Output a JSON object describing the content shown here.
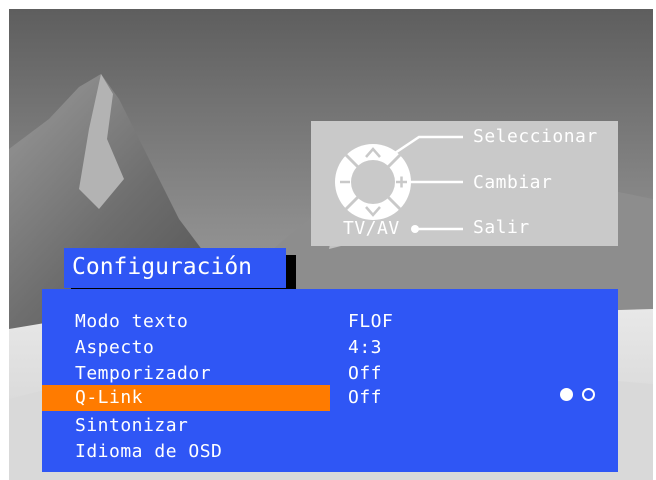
{
  "help_panel": {
    "select_label": "Seleccionar",
    "change_label": "Cambiar",
    "exit_label": "Salir",
    "tvav_label": "TV/AV",
    "icons": [
      "up-arrow-icon",
      "down-arrow-icon",
      "minus-icon",
      "plus-icon",
      "navigation-ring-icon"
    ]
  },
  "menu": {
    "title": "Configuración",
    "items": [
      {
        "label": "Modo texto",
        "value": "FLOF"
      },
      {
        "label": "Aspecto",
        "value": "4:3"
      },
      {
        "label": "Temporizador",
        "value": "Off"
      },
      {
        "label": "Q-Link",
        "value": "Off",
        "selected": true
      },
      {
        "label": "Sintonizar",
        "value": ""
      },
      {
        "label": "Idioma de OSD",
        "value": ""
      }
    ],
    "pagination": {
      "current": 1,
      "total": 2
    }
  },
  "colors": {
    "menu_blue": "#2f56f5",
    "highlight_orange": "#ff7b00",
    "help_panel_gray": "#c9c9c9",
    "text": "#ffffff"
  }
}
